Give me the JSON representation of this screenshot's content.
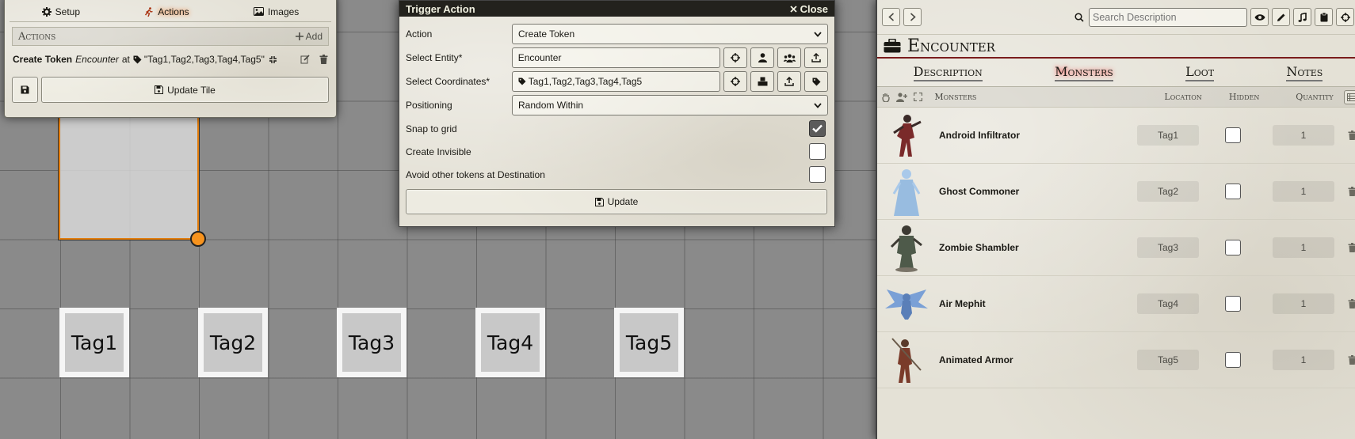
{
  "canvas": {
    "tags": [
      "Tag1",
      "Tag2",
      "Tag3",
      "Tag4",
      "Tag5"
    ]
  },
  "tile_config": {
    "tabs": [
      {
        "label": "Setup",
        "icon": "gear-icon",
        "active": false
      },
      {
        "label": "Actions",
        "icon": "running-person-icon",
        "active": true
      },
      {
        "label": "Images",
        "icon": "image-icon",
        "active": false
      }
    ],
    "actions_header": "Actions",
    "add_label": "Add",
    "action": {
      "verb": "Create Token",
      "entity": "Encounter",
      "at": "at",
      "target": "\"Tag1,Tag2,Tag3,Tag4,Tag5\""
    },
    "update_tile_label": "Update Tile"
  },
  "dialog": {
    "title": "Trigger Action",
    "close_label": "Close",
    "fields": {
      "action_label": "Action",
      "action_value": "Create Token",
      "entity_label": "Select Entity*",
      "entity_value": "Encounter",
      "coords_label": "Select Coordinates*",
      "coords_value": "Tag1,Tag2,Tag3,Tag4,Tag5",
      "positioning_label": "Positioning",
      "positioning_value": "Random Within",
      "snap_label": "Snap to grid",
      "snap_checked": true,
      "invisible_label": "Create Invisible",
      "invisible_checked": false,
      "avoid_label": "Avoid other tokens at Destination",
      "avoid_checked": false
    },
    "update_label": "Update"
  },
  "journal": {
    "search_placeholder": "Search Description",
    "title": "Encounter",
    "tabs": [
      {
        "label": "Description",
        "active": false
      },
      {
        "label": "Monsters",
        "active": true
      },
      {
        "label": "Loot",
        "active": false
      },
      {
        "label": "Notes",
        "active": false
      }
    ],
    "columns": {
      "monsters": "Monsters",
      "location": "Location",
      "hidden": "Hidden",
      "quantity": "Quantity"
    },
    "monsters": [
      {
        "name": "Android Infiltrator",
        "location": "Tag1",
        "hidden": false,
        "quantity": "1",
        "color": "#7a2a2a"
      },
      {
        "name": "Ghost Commoner",
        "location": "Tag2",
        "hidden": false,
        "quantity": "1",
        "color": "#8fb7e0"
      },
      {
        "name": "Zombie Shambler",
        "location": "Tag3",
        "hidden": false,
        "quantity": "1",
        "color": "#4e5a4a"
      },
      {
        "name": "Air Mephit",
        "location": "Tag4",
        "hidden": false,
        "quantity": "1",
        "color": "#5a7fb8"
      },
      {
        "name": "Animated Armor",
        "location": "Tag5",
        "hidden": false,
        "quantity": "1",
        "color": "#7a3b2a"
      }
    ]
  }
}
